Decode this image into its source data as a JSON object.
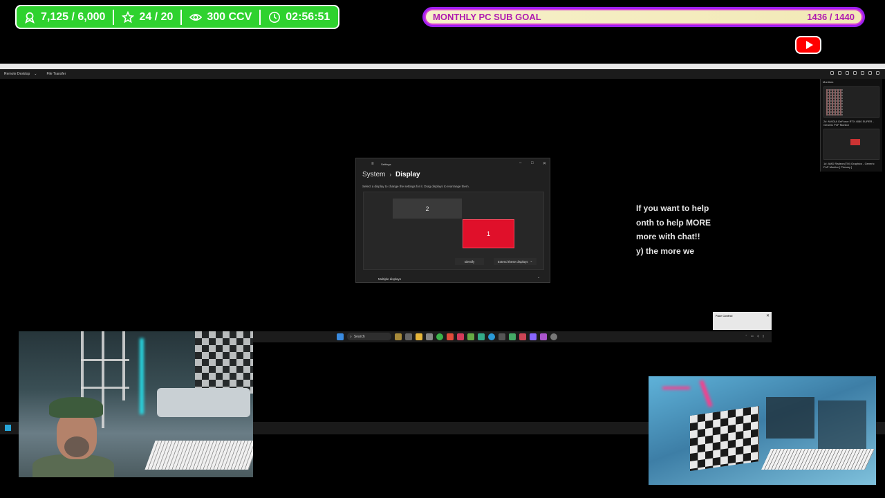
{
  "stats": {
    "followers": "7,125 / 6,000",
    "subs": "24 / 20",
    "ccv": "300 CCV",
    "uptime": "02:56:51"
  },
  "sub_goal": {
    "label": "MONTHLY PC SUB GOAL",
    "count": "1436 / 1440",
    "progress": 0.997
  },
  "remote_desktop": {
    "tabs": [
      "Remote Desktop",
      "File Transfer"
    ],
    "monitors_title": "Monitors",
    "monitor_1_label": "2#: NVIDIA GeForce RTX 4080 SUPER - Generic PnP Monitor",
    "monitor_2_label": "1#: AMD Radeon(TM) Graphics - Generic PnP Monitor [ Primary ]"
  },
  "settings": {
    "app_title": "Settings",
    "breadcrumb_parent": "System",
    "breadcrumb_current": "Display",
    "instruction": "Select a display to change the settings for it. Drag displays to rearrange them.",
    "display_2_label": "2",
    "display_1_label": "1",
    "identify_label": "Identify",
    "extend_label": "Extend these displays",
    "multiple_displays_label": "Multiple displays"
  },
  "ticker": {
    "lines": [
      "If you want to help",
      "onth to help MORE",
      " more with chat!!",
      "y) the more we"
    ]
  },
  "notification": {
    "title": "Face Control"
  },
  "taskbar": {
    "search_placeholder": "Search"
  },
  "colors": {
    "stats_bg": "#2fd22f",
    "goal_border": "#a020f0",
    "goal_text": "#b01ab0",
    "display_1": "#e0102a"
  }
}
